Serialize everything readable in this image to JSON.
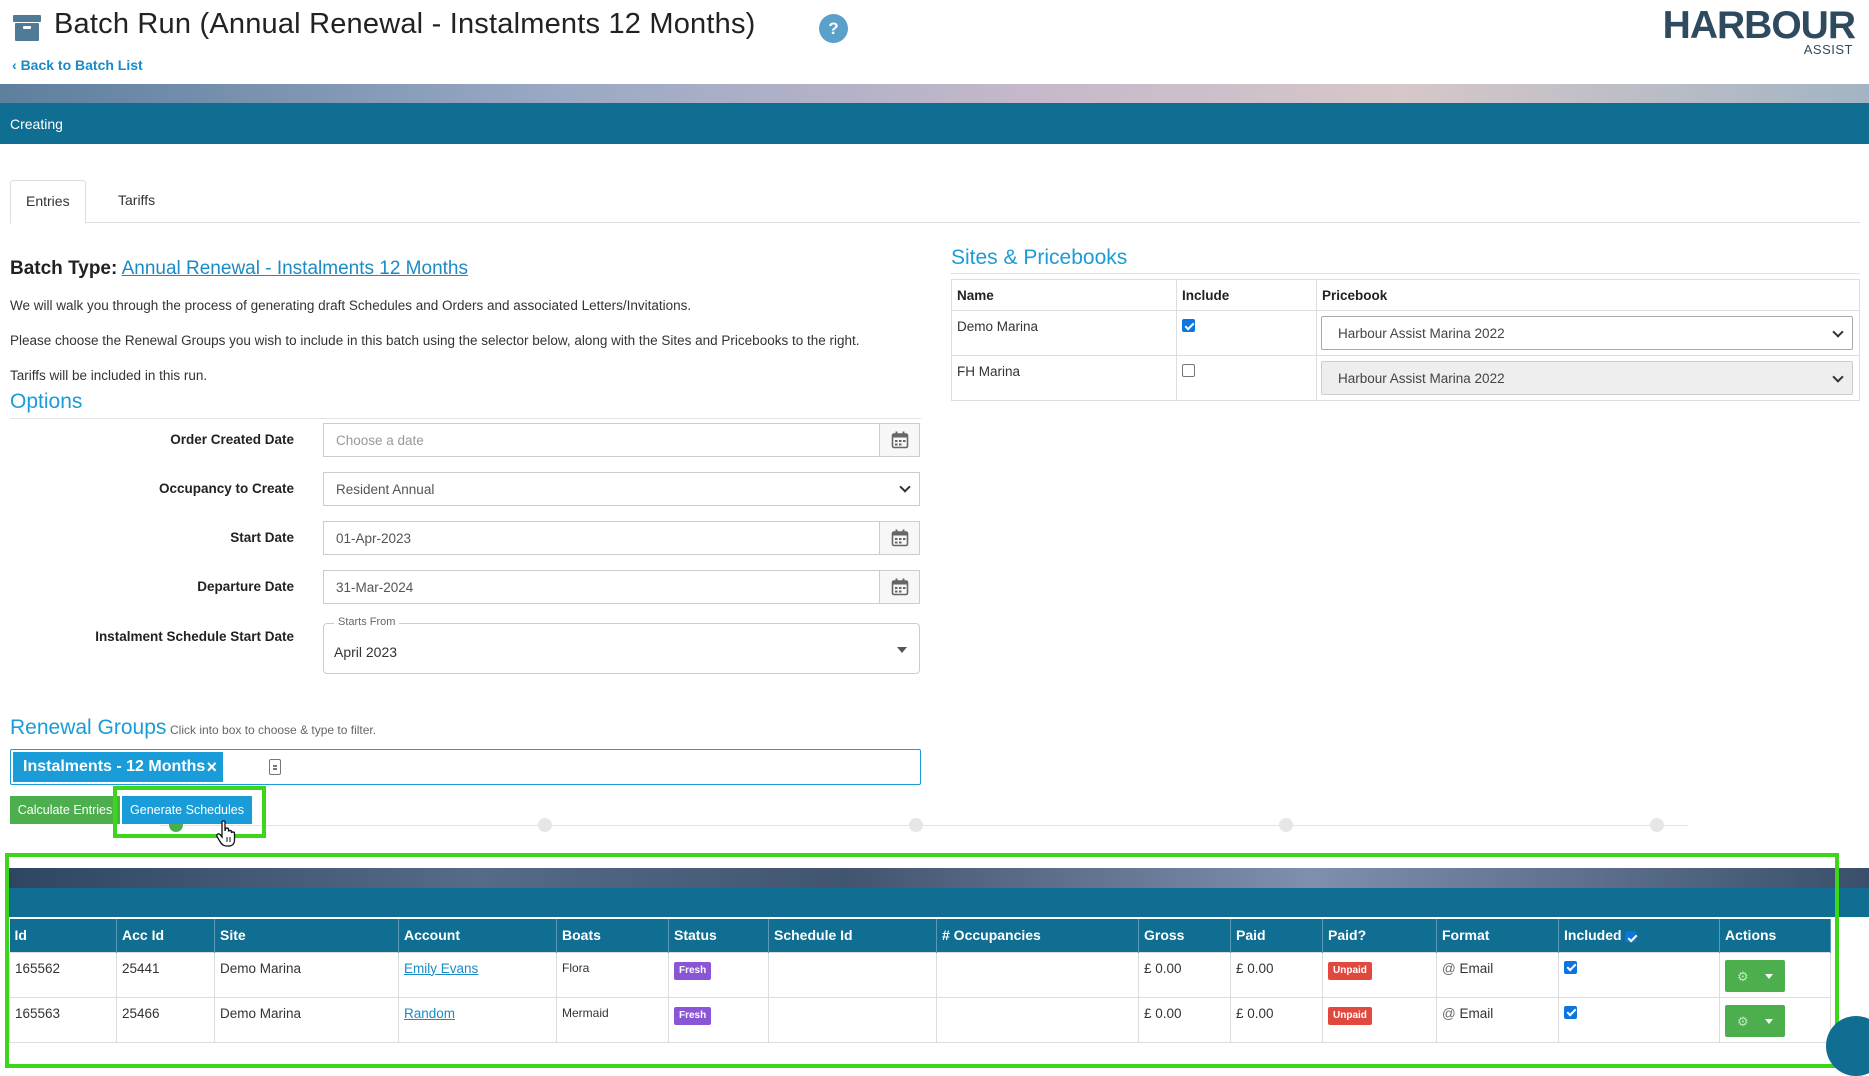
{
  "header": {
    "title": "Batch Run (Annual Renewal - Instalments 12 Months)",
    "help": "?",
    "back_link": "Back to Batch List",
    "logo_main": "HARBOUR",
    "logo_sub": "ASSIST"
  },
  "status": "Creating",
  "tabs": [
    {
      "label": "Entries",
      "active": true
    },
    {
      "label": "Tariffs",
      "active": false
    }
  ],
  "batch": {
    "type_label": "Batch Type:",
    "type_value": "Annual Renewal - Instalments 12 Months",
    "intro_1": "We will walk you through the process of generating draft Schedules and Orders and associated Letters/Invitations.",
    "intro_2": "Please choose the Renewal Groups you wish to include in this batch using the selector below, along with the Sites and Pricebooks to the right.",
    "intro_3": "Tariffs will be included in this run."
  },
  "options": {
    "title": "Options",
    "order_created_label": "Order Created Date",
    "order_created_placeholder": "Choose a date",
    "occupancy_label": "Occupancy to Create",
    "occupancy_value": "Resident Annual",
    "start_label": "Start Date",
    "start_value": "01-Apr-2023",
    "departure_label": "Departure Date",
    "departure_value": "31-Mar-2024",
    "instalment_label": "Instalment Schedule Start Date",
    "instalment_legend": "Starts From",
    "instalment_value": "April 2023"
  },
  "renewal_groups": {
    "title": "Renewal Groups",
    "hint": "Click into box to choose & type to filter.",
    "chip": "Instalments - 12 Months",
    "chip_remove": "×"
  },
  "actions": {
    "calculate": "Calculate Entries",
    "generate": "Generate Schedules"
  },
  "sites": {
    "title": "Sites & Pricebooks",
    "headers": [
      "Name",
      "Include",
      "Pricebook"
    ],
    "rows": [
      {
        "name": "Demo Marina",
        "include": true,
        "pricebook": "Harbour Assist Marina 2022"
      },
      {
        "name": "FH Marina",
        "include": false,
        "pricebook": "Harbour Assist Marina 2022"
      }
    ]
  },
  "entries": {
    "headers": [
      "Id",
      "Acc Id",
      "Site",
      "Account",
      "Boats",
      "Status",
      "Schedule Id",
      "# Occupancies",
      "Gross",
      "Paid",
      "Paid?",
      "Format",
      "Included",
      "Actions"
    ],
    "rows": [
      {
        "id": "165562",
        "acc_id": "25441",
        "site": "Demo Marina",
        "account": "Emily Evans",
        "boats": "Flora",
        "status": "Fresh",
        "schedule_id": "",
        "occupancies": "",
        "gross": "£ 0.00",
        "paid": "£ 0.00",
        "paid_status": "Unpaid",
        "format": "Email",
        "included": true
      },
      {
        "id": "165563",
        "acc_id": "25466",
        "site": "Demo Marina",
        "account": "Random",
        "boats": "Mermaid",
        "status": "Fresh",
        "schedule_id": "",
        "occupancies": "",
        "gross": "£ 0.00",
        "paid": "£ 0.00",
        "paid_status": "Unpaid",
        "format": "Email",
        "included": true
      }
    ]
  },
  "colors": {
    "primary": "#0f6e92",
    "accent": "#1a9cd8",
    "success": "#4cae4c",
    "fresh": "#8a56d6",
    "unpaid": "#e1493e",
    "highlight": "#3cd61a"
  }
}
